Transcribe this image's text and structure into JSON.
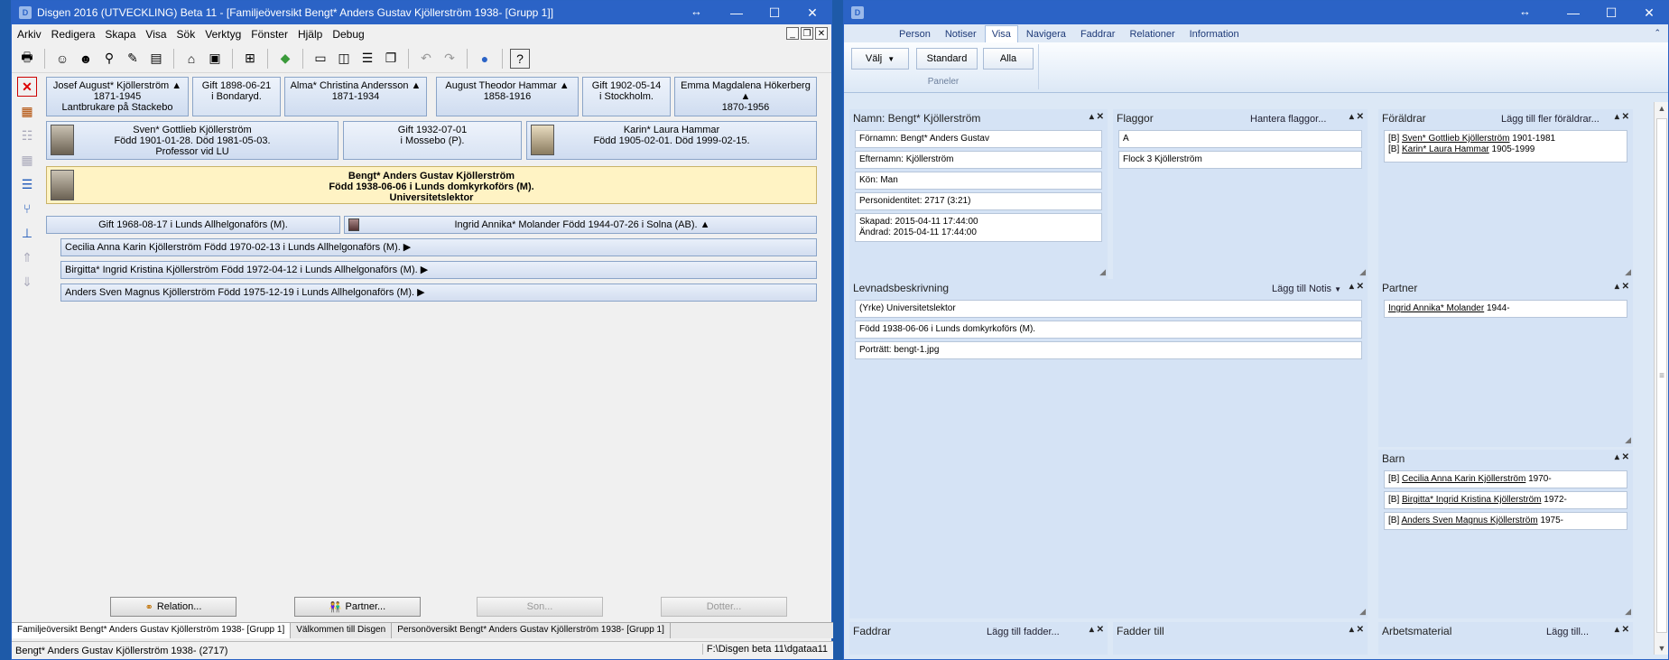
{
  "left_window": {
    "title": "Disgen 2016 (UTVECKLING) Beta 11 - [Familjeöversikt Bengt* Anders Gustav Kjöllerström 1938- [Grupp 1]]",
    "menu": [
      "Arkiv",
      "Redigera",
      "Skapa",
      "Visa",
      "Sök",
      "Verktyg",
      "Fönster",
      "Hjälp",
      "Debug"
    ],
    "grandparents": [
      {
        "line1": "Josef August* Kjöllerström ▲",
        "line2": "1871-1945",
        "line3": "Lantbrukare på Stackebo"
      },
      {
        "line1": "Gift 1898-06-21",
        "line2": "i Bondaryd.",
        "line3": ""
      },
      {
        "line1": "Alma* Christina Andersson ▲",
        "line2": "1871-1934",
        "line3": ""
      },
      {
        "line1": "August Theodor Hammar ▲",
        "line2": "1858-1916",
        "line3": ""
      },
      {
        "line1": "Gift 1902-05-14",
        "line2": "i Stockholm.",
        "line3": ""
      },
      {
        "line1": "Emma Magdalena Hökerberg ▲",
        "line2": "1870-1956",
        "line3": ""
      }
    ],
    "parents": [
      {
        "line1": "Sven* Gottlieb Kjöllerström",
        "line2": "Född 1901-01-28. Död 1981-05-03.",
        "line3": "Professor vid LU"
      },
      {
        "line1": "Gift 1932-07-01",
        "line2": "i Mossebo (P).",
        "line3": ""
      },
      {
        "line1": "Karin* Laura Hammar",
        "line2": "Född 1905-02-01. Död 1999-02-15.",
        "line3": ""
      }
    ],
    "main_person": {
      "line1": "Bengt* Anders Gustav Kjöllerström",
      "line2": "Född 1938-06-06 i Lunds domkyrkoförs (M).",
      "line3": "Universitetslektor"
    },
    "marriage": "Gift 1968-08-17 i Lunds Allhelgonaförs (M).",
    "spouse": "Ingrid Annika* Molander Född 1944-07-26 i Solna (AB). ▲",
    "children": [
      "Cecilia Anna Karin Kjöllerström Född 1970-02-13 i Lunds Allhelgonaförs (M). ▶",
      "Birgitta* Ingrid Kristina Kjöllerström Född 1972-04-12 i Lunds Allhelgonaförs (M). ▶",
      "Anders Sven Magnus Kjöllerström Född 1975-12-19 i Lunds Allhelgonaförs (M). ▶"
    ],
    "buttons": {
      "relation": "Relation...",
      "partner": "Partner...",
      "son": "Son...",
      "dotter": "Dotter..."
    },
    "tabs": [
      "Familjeöversikt Bengt* Anders Gustav Kjöllerström 1938- [Grupp 1]",
      "Välkommen till Disgen",
      "Personöversikt Bengt* Anders Gustav Kjöllerström 1938- [Grupp 1]"
    ],
    "status": "Bengt* Anders Gustav Kjöllerström 1938- (2717)",
    "status_path": "F:\\Disgen beta 11\\dgataa11"
  },
  "right_window": {
    "ribbon_tabs": [
      "Person",
      "Notiser",
      "Visa",
      "Navigera",
      "Faddrar",
      "Relationer",
      "Information"
    ],
    "active_tab": "Visa",
    "ribbon_buttons": {
      "valj": "Välj",
      "standard": "Standard",
      "alla": "Alla"
    },
    "ribbon_group": "Paneler",
    "namn_panel": {
      "title": "Namn: Bengt* Kjöllerström",
      "fields": [
        "Förnamn: Bengt* Anders Gustav",
        "Efternamn: Kjöllerström",
        "Kön: Man",
        "Personidentitet: 2717 (3:21)"
      ],
      "created": "Skapad: 2015-04-11 17:44:00",
      "changed": "Ändrad: 2015-04-11 17:44:00"
    },
    "flaggor_panel": {
      "title": "Flaggor",
      "action": "Hantera flaggor...",
      "fields": [
        "A",
        "Flock 3 Kjöllerström"
      ]
    },
    "foraldrar_panel": {
      "title": "Föräldrar",
      "action": "Lägg till fler föräldrar...",
      "entries": [
        {
          "prefix": "[B]",
          "name": "Sven* Gottlieb Kjöllerström",
          "years": "1901-1981"
        },
        {
          "prefix": "[B]",
          "name": "Karin* Laura Hammar",
          "years": "1905-1999"
        }
      ]
    },
    "levnad_panel": {
      "title": "Levnadsbeskrivning",
      "action": "Lägg till Notis",
      "fields": [
        "(Yrke) Universitetslektor",
        "Född 1938-06-06 i Lunds domkyrkoförs (M).",
        "Porträtt: bengt-1.jpg"
      ]
    },
    "partner_panel": {
      "title": "Partner",
      "name": "Ingrid Annika* Molander",
      "years": "1944-"
    },
    "barn_panel": {
      "title": "Barn",
      "entries": [
        {
          "prefix": "[B]",
          "name": "Cecilia Anna Karin Kjöllerström",
          "years": "1970-"
        },
        {
          "prefix": "[B]",
          "name": "Birgitta* Ingrid Kristina Kjöllerström",
          "years": "1972-"
        },
        {
          "prefix": "[B]",
          "name": "Anders Sven Magnus Kjöllerström",
          "years": "1975-"
        }
      ]
    },
    "faddrar_panel": {
      "title": "Faddrar",
      "action": "Lägg till fadder..."
    },
    "fadder_till_panel": {
      "title": "Fadder till"
    },
    "arbetsmaterial_panel": {
      "title": "Arbetsmaterial",
      "action": "Lägg till..."
    }
  }
}
